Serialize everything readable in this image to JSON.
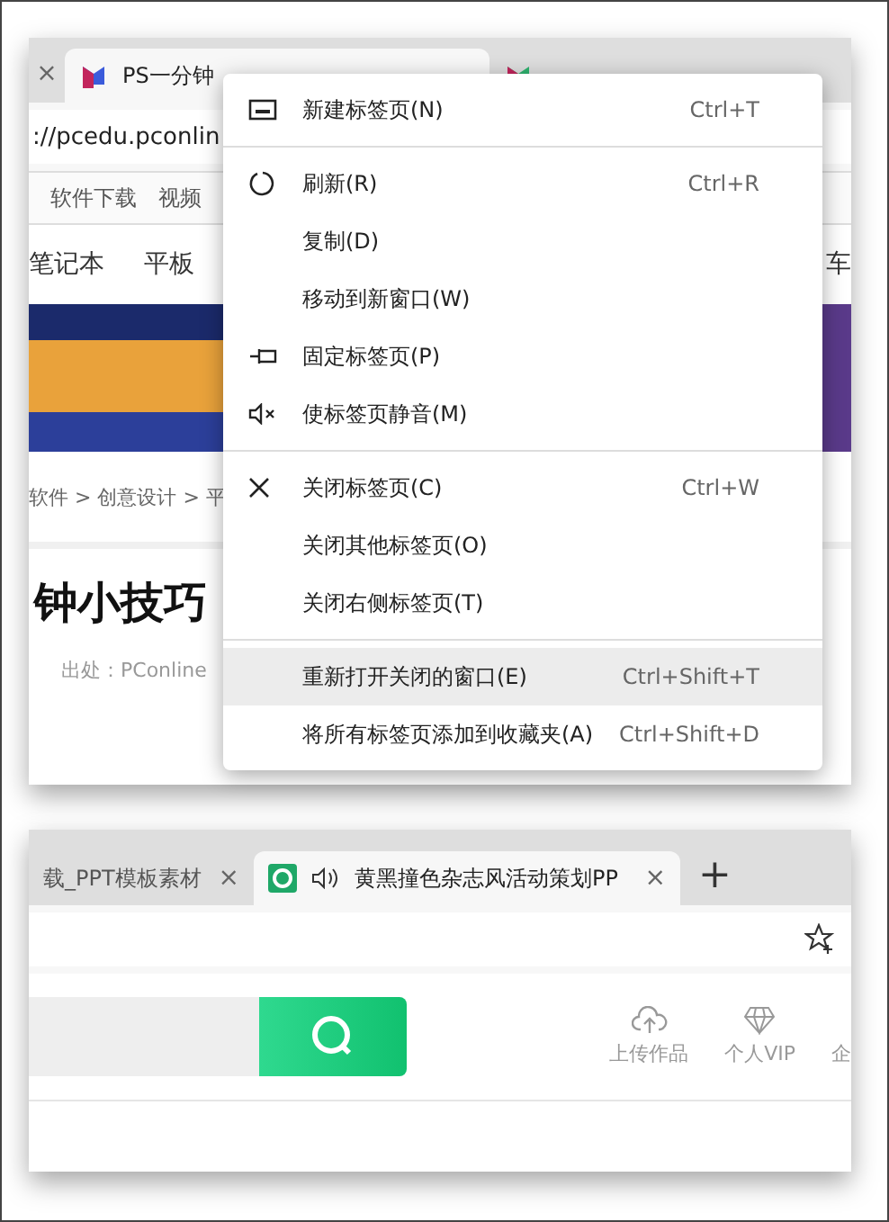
{
  "top_window": {
    "left_close": "×",
    "tabs": [
      {
        "title": "PS一分钟",
        "selected": true
      },
      {
        "selected": false
      }
    ],
    "address": "://pcedu.pconlin",
    "bookmarks": [
      "软件下载",
      "视频"
    ],
    "nav": [
      "笔记本",
      "平板",
      "车"
    ],
    "breadcrumb": "软件 > 创意设计 > 平",
    "headline_left": "钟小技巧",
    "source": "出处：PConline"
  },
  "context_menu": {
    "groups": [
      [
        {
          "label": "新建标签页(N)",
          "shortcut": "Ctrl+T",
          "selected": false
        }
      ],
      [
        {
          "label": "刷新(R)",
          "shortcut": "Ctrl+R",
          "selected": false
        },
        {
          "label": "复制(D)",
          "selected": false
        },
        {
          "label": "移动到新窗口(W)",
          "selected": false
        },
        {
          "label": "固定标签页(P)",
          "selected": false
        },
        {
          "label": "使标签页静音(M)",
          "selected": false
        }
      ],
      [
        {
          "label": "关闭标签页(C)",
          "shortcut": "Ctrl+W",
          "selected": false
        },
        {
          "label": "关闭其他标签页(O)",
          "selected": false
        },
        {
          "label": "关闭右侧标签页(T)",
          "selected": false
        }
      ],
      [
        {
          "label": "重新打开关闭的窗口(E)",
          "shortcut": "Ctrl+Shift+T",
          "selected": true
        },
        {
          "label": "将所有标签页添加到收藏夹(A)",
          "shortcut": "Ctrl+Shift+D",
          "selected": false
        }
      ]
    ]
  },
  "bottom_window": {
    "tabs": [
      {
        "title": "载_PPT模板素材",
        "close": "×",
        "selected": false,
        "audio": false
      },
      {
        "title": "黄黑撞色杂志风活动策划PP",
        "close": "×",
        "selected": true,
        "audio": true
      }
    ],
    "new_tab": "+",
    "actions": [
      "上传作品",
      "个人VIP",
      "企"
    ]
  }
}
